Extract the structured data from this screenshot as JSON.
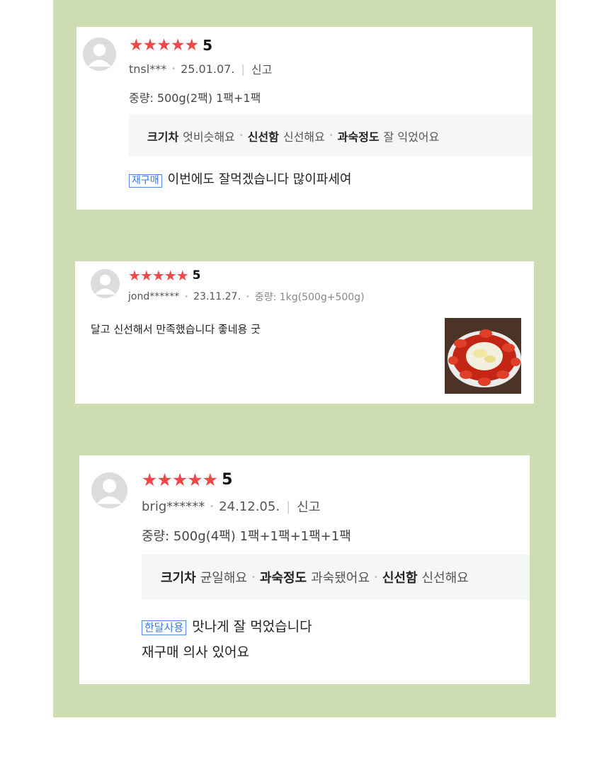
{
  "reviews": [
    {
      "stars": "★★★★★",
      "score": "5",
      "user": "tnsl***",
      "date": "25.01.07.",
      "report": "신고",
      "option": "중량: 500g(2팩) 1팩+1팩",
      "attributes": [
        {
          "name": "크기차",
          "value": "엇비슷해요"
        },
        {
          "name": "신선함",
          "value": "신선해요"
        },
        {
          "name": "과숙정도",
          "value": "잘 익었어요"
        }
      ],
      "badge": "재구매",
      "text": "이번에도 잘먹겠습니다 많이파세여"
    },
    {
      "stars": "★★★★★",
      "score": "5",
      "user": "jond******",
      "date": "23.11.27.",
      "option": "중량: 1kg(500g+500g)",
      "text": "달고 신선해서 만족했습니다 좋네용 굿",
      "thumb_label": "photo-thumbnail"
    },
    {
      "stars": "★★★★★",
      "score": "5",
      "user": "brig******",
      "date": "24.12.05.",
      "report": "신고",
      "option": "중량: 500g(4팩) 1팩+1팩+1팩+1팩",
      "attributes": [
        {
          "name": "크기차",
          "value": "균일해요"
        },
        {
          "name": "과숙정도",
          "value": "과숙됐어요"
        },
        {
          "name": "신선함",
          "value": "신선해요"
        }
      ],
      "badge": "한달사용",
      "text": "맛나게 잘 먹었습니다",
      "text2": "재구매 의사 있어요"
    }
  ],
  "colors": {
    "background_panel": "#cddcb1",
    "star": "#f04848",
    "badge": "#3a7ae0"
  }
}
